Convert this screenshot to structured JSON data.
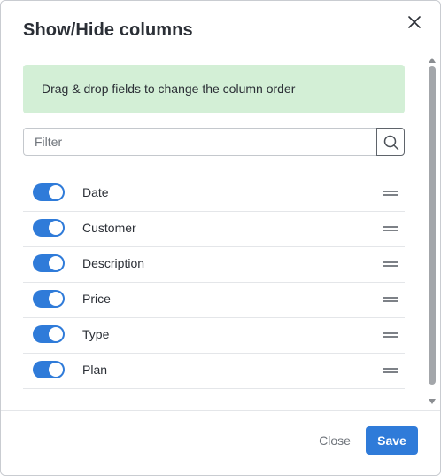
{
  "dialog": {
    "title": "Show/Hide columns",
    "close_icon": "close-icon"
  },
  "banner": {
    "text": "Drag & drop fields to change the column order"
  },
  "filter": {
    "placeholder": "Filter",
    "value": "",
    "search_icon": "search-icon"
  },
  "columns": [
    {
      "label": "Date",
      "enabled": true
    },
    {
      "label": "Customer",
      "enabled": true
    },
    {
      "label": "Description",
      "enabled": true
    },
    {
      "label": "Price",
      "enabled": true
    },
    {
      "label": "Type",
      "enabled": true
    },
    {
      "label": "Plan",
      "enabled": true
    }
  ],
  "footer": {
    "close_label": "Close",
    "save_label": "Save"
  },
  "colors": {
    "accent": "#2f7bd9",
    "banner_bg": "#d3efd6",
    "text": "#2b2f36",
    "muted": "#6f747b"
  },
  "icons": {
    "drag_handle": "drag-handle-icon"
  }
}
